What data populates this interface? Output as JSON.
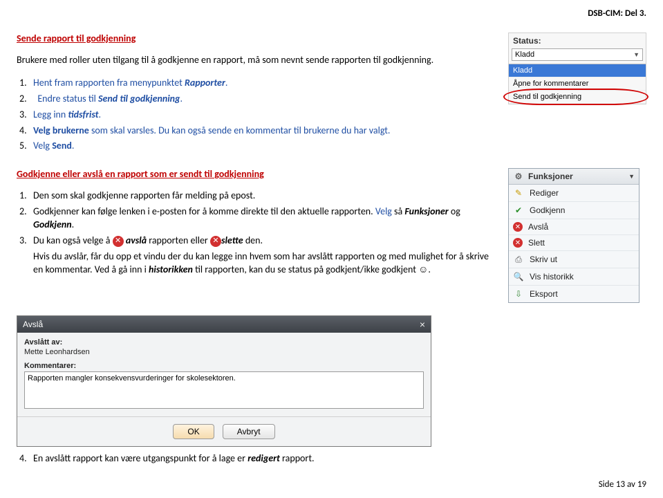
{
  "header": {
    "doc_part": "DSB-CIM: Del 3."
  },
  "sectionA": {
    "title": "Sende rapport til godkjenning",
    "intro": "Brukere med roller uten tilgang til å godkjenne en rapport, må som nevnt sende rapporten til godkjenning.",
    "steps": {
      "s1a": "Hent fram rapporten fra menypunktet ",
      "s1b": "Rapporter",
      "s1c": ".",
      "s2a": "Endre status til ",
      "s2b": "Send til godkjenning",
      "s2c": ".",
      "s3a": "Legg inn ",
      "s3b": "tidsfrist",
      "s3c": ".",
      "s4a": "Velg brukerne",
      "s4b": " som skal varsles. Du kan også sende en kommentar til brukerne du har valgt.",
      "s5a": "Velg ",
      "s5b": "Send",
      "s5c": "."
    }
  },
  "statusBox": {
    "label": "Status:",
    "selected": "Kladd",
    "opts": {
      "o1": "Kladd",
      "o2": "Åpne for kommentarer",
      "o3": "Send til godkjenning"
    }
  },
  "sectionB": {
    "title": "Godkjenne  eller avslå en rapport som er sendt til godkjenning",
    "steps": {
      "s1": "Den  som skal godkjenne rapporten får melding på epost.",
      "s2a": "Godkjenner kan følge lenken i e-posten for å komme direkte til den aktuelle rapporten.   ",
      "s2b": "Velg",
      "s2c": " så  ",
      "s2d": "Funksjoner",
      "s2e": " og ",
      "s2f": "Godkjenn",
      "s2g": ".",
      "s3a": "Du kan også velge å ",
      "s3b": "avslå",
      "s3c": " rapporten eller ",
      "s3d": "slette",
      "s3e": " den.",
      "s3_note1": "Hvis du avslår, får du opp et vindu der du kan legge inn hvem som har avslått rapporten og med mulighet for å skrive en kommentar. Ved å gå inn i ",
      "s3_note2": "historikken",
      "s3_note3": " til rapporten, kan du se status på godkjent/ikke godkjent ",
      "s3_note4": "☺",
      "s3_note5": ".",
      "s4a": "En avslått rapport kan være utgangspunkt for å lage er ",
      "s4b": "redigert",
      "s4c": " rapport."
    }
  },
  "funcMenu": {
    "header": "Funksjoner",
    "items": {
      "i1": "Rediger",
      "i2": "Godkjenn",
      "i3": "Avslå",
      "i4": "Slett",
      "i5": "Skriv ut",
      "i6": "Vis historikk",
      "i7": "Eksport"
    }
  },
  "dialog": {
    "title": "Avslå",
    "label1": "Avslått av:",
    "val1": "Mette Leonhardsen",
    "label2": "Kommentarer:",
    "textarea": "Rapporten mangler konsekvensvurderinger for skolesektoren.",
    "ok": "OK",
    "cancel": "Avbryt"
  },
  "footer": {
    "page": "Side 13 av 19"
  }
}
